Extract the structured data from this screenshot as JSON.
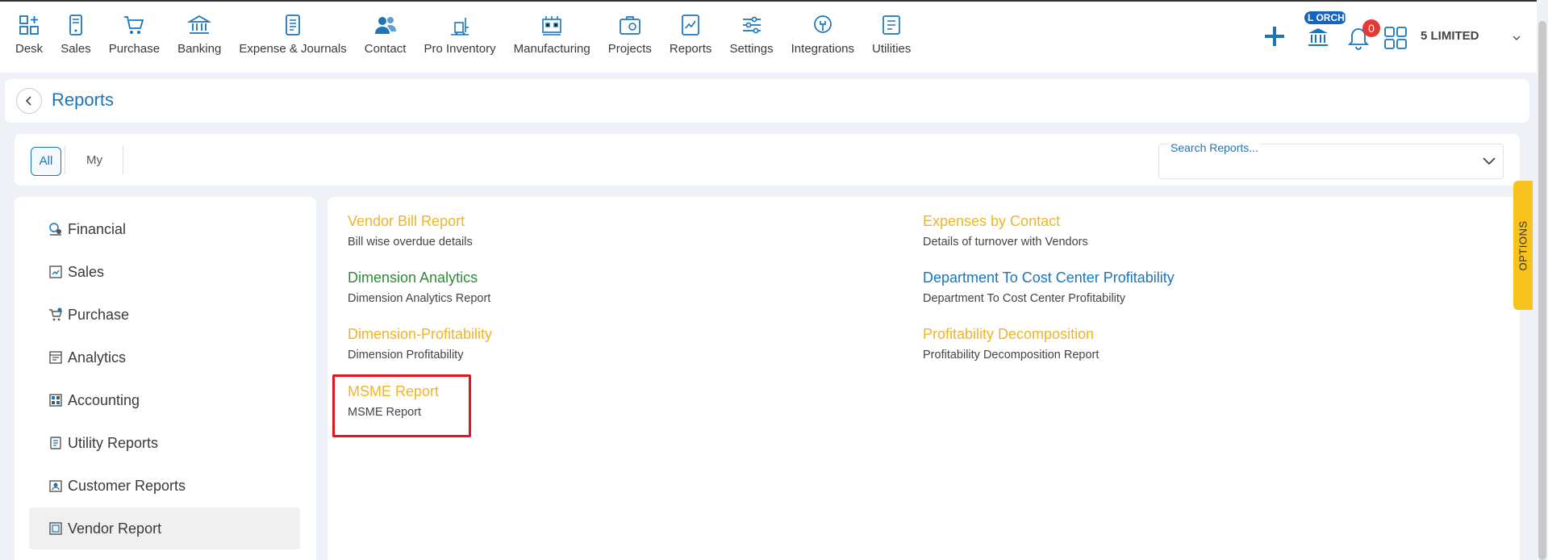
{
  "nav": [
    {
      "label": "Desk",
      "icon": "desk-icon"
    },
    {
      "label": "Sales",
      "icon": "sales-icon"
    },
    {
      "label": "Purchase",
      "icon": "cart-icon"
    },
    {
      "label": "Banking",
      "icon": "bank-icon"
    },
    {
      "label": "Expense & Journals",
      "icon": "journal-icon"
    },
    {
      "label": "Contact",
      "icon": "contact-icon"
    },
    {
      "label": "Pro Inventory",
      "icon": "inventory-icon"
    },
    {
      "label": "Manufacturing",
      "icon": "factory-icon"
    },
    {
      "label": "Projects",
      "icon": "projects-icon"
    },
    {
      "label": "Reports",
      "icon": "reports-icon"
    },
    {
      "label": "Settings",
      "icon": "sliders-icon"
    },
    {
      "label": "Integrations",
      "icon": "integration-icon"
    },
    {
      "label": "Utilities",
      "icon": "utilities-icon"
    }
  ],
  "topright": {
    "org_badge": "L ORCHI",
    "notif_count": "0",
    "company": "5 LIMITED"
  },
  "header": {
    "title": "Reports"
  },
  "filters": {
    "tabs": [
      "All",
      "My"
    ],
    "active": "All",
    "search_label": "Search Reports...",
    "search_value": ""
  },
  "sidebar": {
    "items": [
      {
        "label": "Financial",
        "icon": "financial-icon"
      },
      {
        "label": "Sales",
        "icon": "sales-report-icon"
      },
      {
        "label": "Purchase",
        "icon": "purchase-report-icon"
      },
      {
        "label": "Analytics",
        "icon": "analytics-icon"
      },
      {
        "label": "Accounting",
        "icon": "accounting-icon"
      },
      {
        "label": "Utility Reports",
        "icon": "utility-report-icon"
      },
      {
        "label": "Customer Reports",
        "icon": "customer-report-icon"
      },
      {
        "label": "Vendor Report",
        "icon": "vendor-report-icon"
      }
    ],
    "active": "Vendor Report"
  },
  "reports": [
    {
      "name": "Vendor Bill Report",
      "desc": "Bill wise overdue details",
      "color": "#f0b429"
    },
    {
      "name": "Expenses by Contact",
      "desc": "Details of turnover with Vendors",
      "color": "#f0b429"
    },
    {
      "name": "Dimension Analytics",
      "desc": "Dimension Analytics Report",
      "color": "#2e8b3a"
    },
    {
      "name": "Department To Cost Center Profitability",
      "desc": "Department To Cost Center Profitability",
      "color": "#1b75bb"
    },
    {
      "name": "Dimension-Profitability",
      "desc": "Dimension Profitability",
      "color": "#f0b429"
    },
    {
      "name": "Profitability Decomposition",
      "desc": "Profitability Decomposition Report",
      "color": "#f0b429"
    },
    {
      "name": "MSME Report",
      "desc": "MSME Report",
      "color": "#f0b429"
    }
  ],
  "options_tab": "OPTIONS"
}
